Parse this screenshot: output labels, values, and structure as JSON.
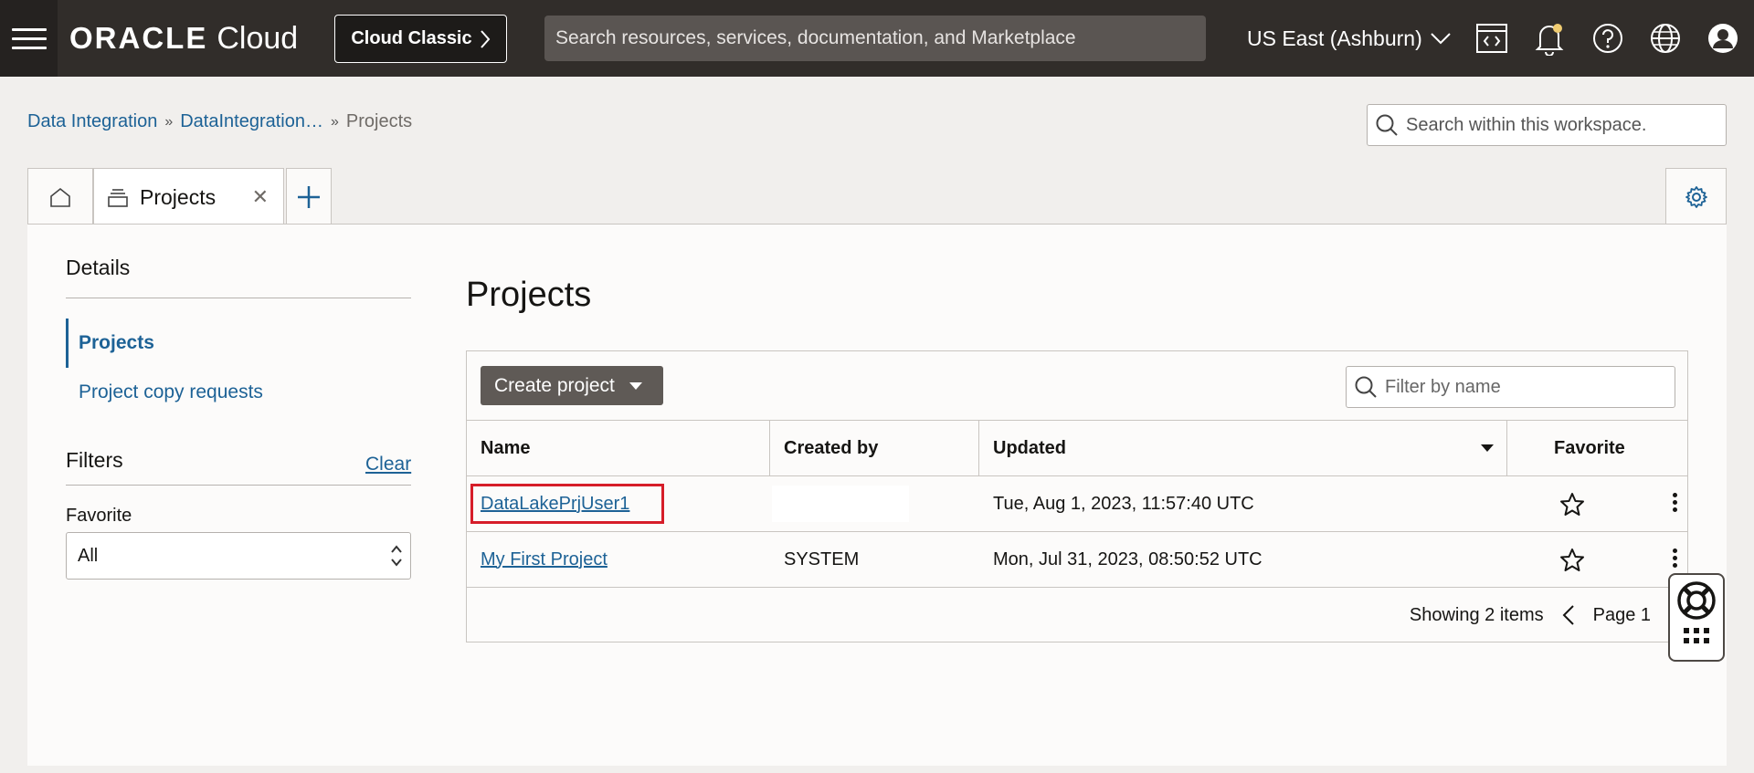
{
  "header": {
    "brand": "ORACLE",
    "product": "Cloud",
    "classic_label": "Cloud Classic",
    "search_placeholder": "Search resources, services, documentation, and Marketplace",
    "region": "US East (Ashburn)"
  },
  "breadcrumb": {
    "items": [
      "Data Integration",
      "DataIntegration…"
    ],
    "current": "Projects"
  },
  "workspace_search": {
    "placeholder": "Search within this workspace."
  },
  "tabs": {
    "active_label": "Projects"
  },
  "sidebar": {
    "details": "Details",
    "items": [
      {
        "label": "Projects",
        "active": true
      },
      {
        "label": "Project copy requests",
        "active": false
      }
    ],
    "filters_title": "Filters",
    "clear_label": "Clear",
    "favorite_label": "Favorite",
    "favorite_value": "All"
  },
  "main": {
    "title": "Projects",
    "create_label": "Create project",
    "filter_placeholder": "Filter by name",
    "columns": [
      "Name",
      "Created by",
      "Updated",
      "Favorite"
    ],
    "rows": [
      {
        "name": "DataLakePrjUser1",
        "created_by": "",
        "updated": "Tue, Aug 1, 2023, 11:57:40 UTC"
      },
      {
        "name": "My First Project",
        "created_by": "SYSTEM",
        "updated": "Mon, Jul 31, 2023, 08:50:52 UTC"
      }
    ],
    "showing": "Showing 2 items",
    "page": "Page 1"
  },
  "colors": {
    "header_bg": "#312d2a",
    "link": "#1d6296",
    "highlight": "#d61d29",
    "button_bg": "#5f5a56"
  }
}
